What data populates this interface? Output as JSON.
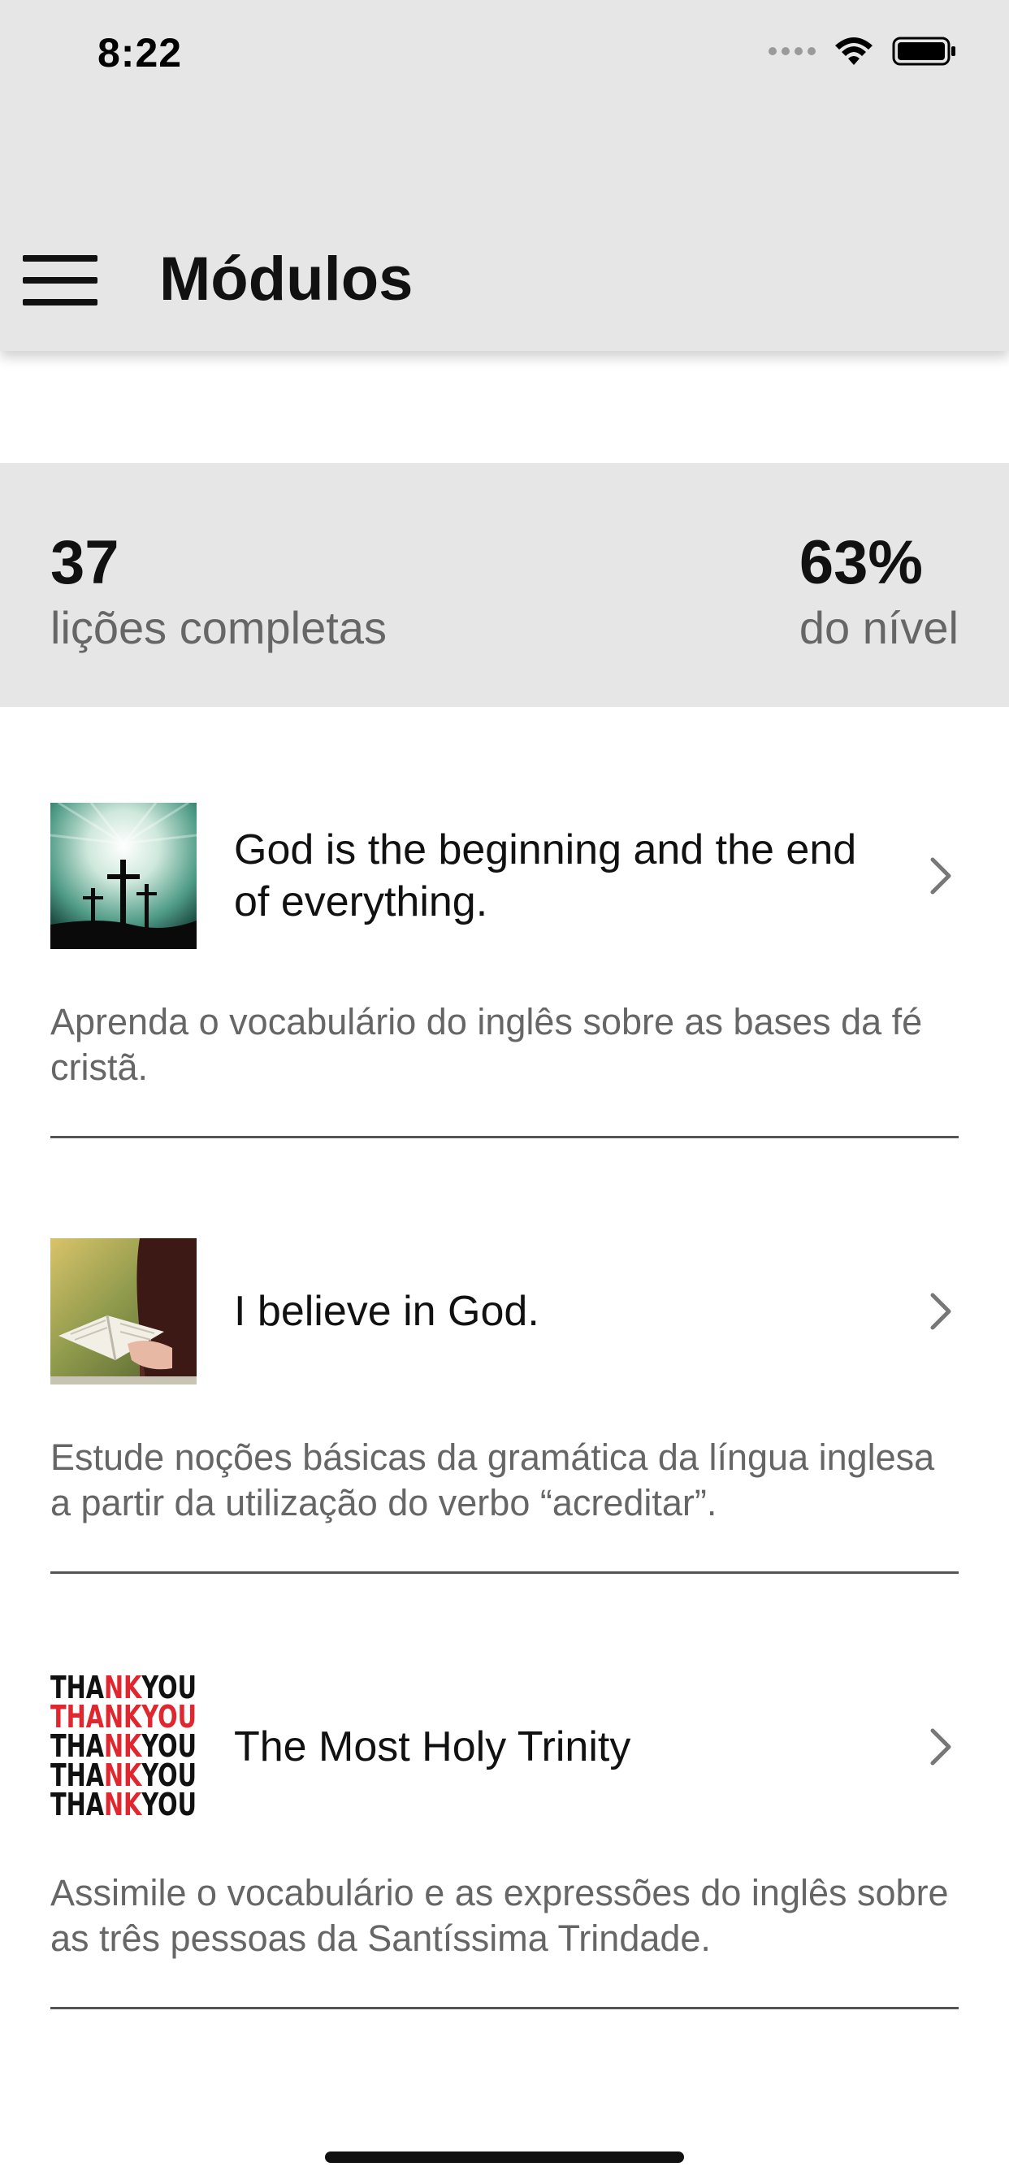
{
  "status_bar": {
    "time": "8:22"
  },
  "header": {
    "title": "Módulos",
    "background": "#e6e6e6"
  },
  "stats": {
    "lessons_value": "37",
    "lessons_label": "lições completas",
    "level_value": "63%",
    "level_label": "do nível"
  },
  "modules": [
    {
      "title": "God is the beginning and the end of everything.",
      "description": "Aprenda o vocabulário do inglês sobre as bases da fé cristã.",
      "thumbnail_icon": "crosses-image"
    },
    {
      "title": "I believe in God.",
      "description": "Estude noções básicas da gramática da língua inglesa a partir da utilização do verbo “acreditar”.",
      "thumbnail_icon": "bible-reading-image"
    },
    {
      "title": "The Most Holy Trinity",
      "description": "Assimile o vocabulário e as expressões do inglês sobre as três pessoas da Santíssima Trindade.",
      "thumbnail_icon": "thank-you-typography-image",
      "thumbnail_text": [
        "THANKYOU",
        "THANKYOU",
        "THANKYOU",
        "THANKYOU",
        "THANKYOU"
      ]
    }
  ],
  "colors": {
    "accent_red": "#e0262e",
    "text_dark": "#111111",
    "text_muted": "#666666"
  }
}
